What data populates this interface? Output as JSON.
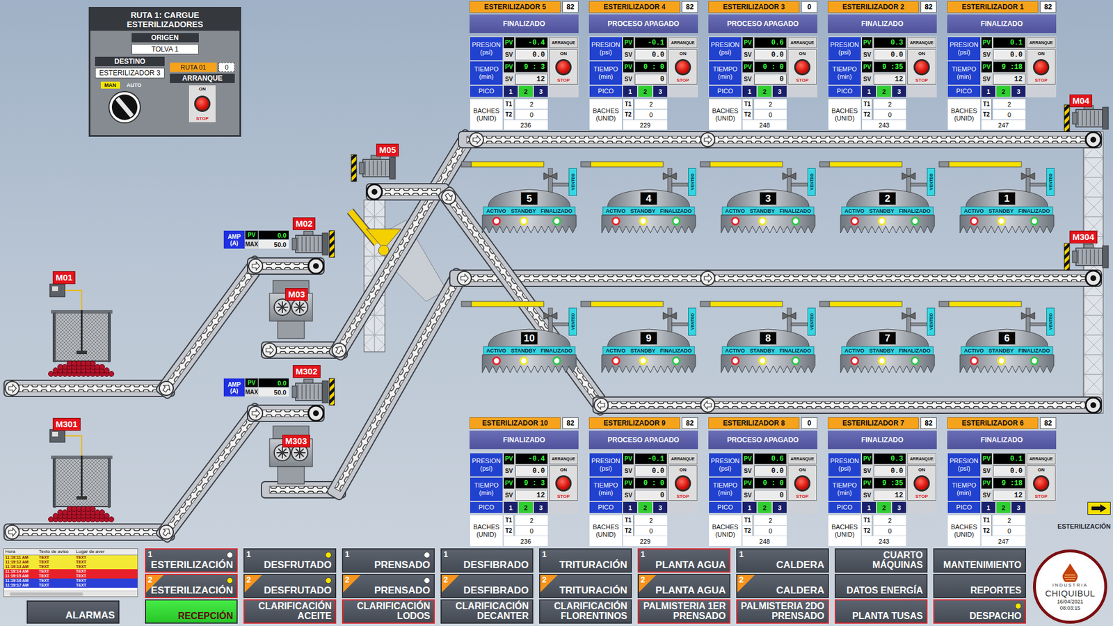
{
  "route_panel": {
    "title": "RUTA 1: CARGUE ESTERILIZADORES",
    "origin_label": "ORIGEN",
    "origin": "TOLVA 1",
    "destination_label": "DESTINO",
    "destination": "ESTERILIZADOR 3",
    "route_label": "RUTA 01",
    "route_value": "0",
    "start_label": "ARRANQUE",
    "modes": [
      {
        "label": "MAN",
        "selected": true
      },
      {
        "label": "AUTO",
        "selected": false
      }
    ],
    "on_label": "ON",
    "stop_label": "STOP"
  },
  "card_labels": {
    "pressure": "PRESION (psi)",
    "time": "TIEMPO (min)",
    "pv": "PV",
    "sv": "SV",
    "start": "ARRANQUE",
    "on": "ON",
    "stop": "STOP",
    "peak": "PICO",
    "batches": "BACHES (UNID)",
    "t1": "T1",
    "t2": "T2"
  },
  "sterilizers_top": [
    {
      "name": "ESTERILIZADOR 5",
      "count": "82",
      "status": "FINALIZADO",
      "pressure_pv": "-0.4",
      "pressure_sv": "0.0",
      "time_pv": "9 : 3",
      "time_sv": "12",
      "peaks": [
        {
          "label": "1",
          "selected": false
        },
        {
          "label": "2",
          "selected": true
        },
        {
          "label": "3",
          "selected": false
        }
      ],
      "t1": "2",
      "t2": "0",
      "total": "236"
    },
    {
      "name": "ESTERILIZADOR 4",
      "count": "82",
      "status": "PROCESO APAGADO",
      "pressure_pv": "-0.1",
      "pressure_sv": "0.0",
      "time_pv": "0 : 0",
      "time_sv": "0",
      "peaks": [
        {
          "label": "1",
          "selected": false
        },
        {
          "label": "2",
          "selected": true
        },
        {
          "label": "3",
          "selected": false
        }
      ],
      "t1": "2",
      "t2": "0",
      "total": "229"
    },
    {
      "name": "ESTERILIZADOR 3",
      "count": "0",
      "status": "PROCESO APAGADO",
      "pressure_pv": "0.6",
      "pressure_sv": "0.0",
      "time_pv": "0 : 0",
      "time_sv": "0",
      "peaks": [
        {
          "label": "1",
          "selected": false
        },
        {
          "label": "2",
          "selected": true
        },
        {
          "label": "3",
          "selected": false
        }
      ],
      "t1": "2",
      "t2": "0",
      "total": "248"
    },
    {
      "name": "ESTERILIZADOR 2",
      "count": "82",
      "status": "FINALIZADO",
      "pressure_pv": "0.3",
      "pressure_sv": "0.0",
      "time_pv": "9 :35",
      "time_sv": "12",
      "peaks": [
        {
          "label": "1",
          "selected": false
        },
        {
          "label": "2",
          "selected": true
        },
        {
          "label": "3",
          "selected": false
        }
      ],
      "t1": "2",
      "t2": "0",
      "total": "243"
    },
    {
      "name": "ESTERILIZADOR 1",
      "count": "82",
      "status": "FINALIZADO",
      "pressure_pv": "0.1",
      "pressure_sv": "0.0",
      "time_pv": "9 :18",
      "time_sv": "12",
      "peaks": [
        {
          "label": "1",
          "selected": false
        },
        {
          "label": "2",
          "selected": true
        },
        {
          "label": "3",
          "selected": false
        }
      ],
      "t1": "2",
      "t2": "0",
      "total": "247"
    }
  ],
  "sterilizers_bottom": [
    {
      "name": "ESTERILIZADOR 10",
      "count": "82",
      "status": "FINALIZADO",
      "pressure_pv": "-0.4",
      "pressure_sv": "0.0",
      "time_pv": "9 : 3",
      "time_sv": "12",
      "peaks": [
        {
          "label": "1",
          "selected": false
        },
        {
          "label": "2",
          "selected": true
        },
        {
          "label": "3",
          "selected": false
        }
      ],
      "t1": "2",
      "t2": "0",
      "total": "236"
    },
    {
      "name": "ESTERILIZADOR 9",
      "count": "82",
      "status": "PROCESO APAGADO",
      "pressure_pv": "-0.1",
      "pressure_sv": "0.0",
      "time_pv": "0 : 0",
      "time_sv": "0",
      "peaks": [
        {
          "label": "1",
          "selected": false
        },
        {
          "label": "2",
          "selected": true
        },
        {
          "label": "3",
          "selected": false
        }
      ],
      "t1": "2",
      "t2": "0",
      "total": "229"
    },
    {
      "name": "ESTERILIZADOR 8",
      "count": "0",
      "status": "PROCESO APAGADO",
      "pressure_pv": "0.6",
      "pressure_sv": "0.0",
      "time_pv": "0 : 0",
      "time_sv": "0",
      "peaks": [
        {
          "label": "1",
          "selected": false
        },
        {
          "label": "2",
          "selected": true
        },
        {
          "label": "3",
          "selected": false
        }
      ],
      "t1": "2",
      "t2": "0",
      "total": "248"
    },
    {
      "name": "ESTERILIZADOR 7",
      "count": "82",
      "status": "FINALIZADO",
      "pressure_pv": "0.3",
      "pressure_sv": "0.0",
      "time_pv": "9 :35",
      "time_sv": "12",
      "peaks": [
        {
          "label": "1",
          "selected": false
        },
        {
          "label": "2",
          "selected": true
        },
        {
          "label": "3",
          "selected": false
        }
      ],
      "t1": "2",
      "t2": "0",
      "total": "243"
    },
    {
      "name": "ESTERILIZADOR 6",
      "count": "82",
      "status": "FINALIZADO",
      "pressure_pv": "0.1",
      "pressure_sv": "0.0",
      "time_pv": "9 :18",
      "time_sv": "12",
      "peaks": [
        {
          "label": "1",
          "selected": false
        },
        {
          "label": "2",
          "selected": true
        },
        {
          "label": "3",
          "selected": false
        }
      ],
      "t1": "2",
      "t2": "0",
      "total": "247"
    }
  ],
  "vessel_labels": {
    "vent": "VENTEO",
    "lights": [
      {
        "label": "ACTIVO",
        "color": "#e5262b",
        "on": false
      },
      {
        "label": "STANDBY",
        "color": "#f3e62a",
        "on": false
      },
      {
        "label": "FINALIZADO",
        "color": "#2cc84a",
        "on": false
      }
    ]
  },
  "vessels_top": [
    {
      "number": "5"
    },
    {
      "number": "4"
    },
    {
      "number": "3"
    },
    {
      "number": "2"
    },
    {
      "number": "1"
    }
  ],
  "vessels_bottom": [
    {
      "number": "10"
    },
    {
      "number": "9"
    },
    {
      "number": "8"
    },
    {
      "number": "7"
    },
    {
      "number": "6"
    }
  ],
  "motors": [
    {
      "label": "M01"
    },
    {
      "label": "M301"
    },
    {
      "label": "M02"
    },
    {
      "label": "M03"
    },
    {
      "label": "M302"
    },
    {
      "label": "M303"
    },
    {
      "label": "M05"
    },
    {
      "label": "M04"
    },
    {
      "label": "M304"
    }
  ],
  "amp_meters": [
    {
      "label": "AMP (A)",
      "pv_label": "PV",
      "pv": "0.0",
      "max_label": "MAX",
      "max": "50.0"
    },
    {
      "label": "AMP (A)",
      "pv_label": "PV",
      "pv": "0.0",
      "max_label": "MAX",
      "max": "50.0"
    }
  ],
  "legend": {
    "label": "ESTERILIZACIÓN"
  },
  "alarms": {
    "columns": [
      "Hora",
      "Texto de aviso",
      "Lugar de aver"
    ],
    "rows": [
      {
        "time": "11:19:11 AM",
        "text": "TEXT",
        "place": "TEXT",
        "color": "#f3e833"
      },
      {
        "time": "11:19:12 AM",
        "text": "TEXT",
        "place": "TEXT",
        "color": "#f3e833"
      },
      {
        "time": "11:19:13 AM",
        "text": "TEXT",
        "place": "TEXT",
        "color": "#f3e833"
      },
      {
        "time": "11:19:14 AM",
        "text": "TEXT",
        "place": "TEXT",
        "color": "#e8202a"
      },
      {
        "time": "11:19:15 AM",
        "text": "TEXT",
        "place": "TEXT",
        "color": "#e8202a"
      },
      {
        "time": "11:19:16 AM",
        "text": "TEXT",
        "place": "TEXT",
        "color": "#2a3fd6"
      },
      {
        "time": "11:19:17 AM",
        "text": "TEXT",
        "place": "TEXT",
        "color": "#2a3fd6"
      }
    ]
  },
  "alarm_button": "ALARMAS",
  "nav": [
    {
      "label": "ESTERILIZACIÓN",
      "number": "1",
      "corner": null,
      "indicator": "#ffffff",
      "alarm": true,
      "selected": false
    },
    {
      "label": "DESFRUTADO",
      "number": "1",
      "corner": null,
      "indicator": "#f5e400",
      "alarm": false,
      "selected": false
    },
    {
      "label": "PRENSADO",
      "number": "1",
      "corner": null,
      "indicator": "#ffffff",
      "alarm": false,
      "selected": false
    },
    {
      "label": "DESFIBRADO",
      "number": "1",
      "corner": null,
      "indicator": null,
      "alarm": false,
      "selected": false
    },
    {
      "label": "TRITURACIÓN",
      "number": "1",
      "corner": null,
      "indicator": null,
      "alarm": false,
      "selected": false
    },
    {
      "label": "PLANTA AGUA",
      "number": "1",
      "corner": null,
      "indicator": null,
      "alarm": true,
      "selected": false
    },
    {
      "label": "CALDERA",
      "number": "1",
      "corner": null,
      "indicator": null,
      "alarm": false,
      "selected": false
    },
    {
      "label": "CUARTO MÁQUINAS",
      "number": null,
      "corner": null,
      "indicator": null,
      "alarm": false,
      "selected": false
    },
    {
      "label": "MANTENIMIENTO",
      "number": null,
      "corner": null,
      "indicator": null,
      "alarm": false,
      "selected": false
    },
    {
      "label": "ESTERILIZACIÓN",
      "number": "2",
      "corner": "#f7941d",
      "indicator": "#f5e400",
      "alarm": true,
      "selected": false
    },
    {
      "label": "DESFRUTADO",
      "number": "2",
      "corner": "#f7941d",
      "indicator": "#f5e400",
      "alarm": false,
      "selected": false
    },
    {
      "label": "PRENSADO",
      "number": "2",
      "corner": "#f7941d",
      "indicator": "#ffffff",
      "alarm": false,
      "selected": false
    },
    {
      "label": "DESFIBRADO",
      "number": "2",
      "corner": "#f7941d",
      "indicator": null,
      "alarm": false,
      "selected": false
    },
    {
      "label": "TRITURACIÓN",
      "number": "2",
      "corner": "#f7941d",
      "indicator": null,
      "alarm": false,
      "selected": false
    },
    {
      "label": "PLANTA AGUA",
      "number": "2",
      "corner": "#f7941d",
      "indicator": null,
      "alarm": false,
      "selected": false
    },
    {
      "label": "CALDERA",
      "number": "2",
      "corner": "#f7941d",
      "indicator": null,
      "alarm": false,
      "selected": false
    },
    {
      "label": "DATOS ENERGÍA",
      "number": null,
      "corner": null,
      "indicator": null,
      "alarm": false,
      "selected": false
    },
    {
      "label": "REPORTES",
      "number": null,
      "corner": null,
      "indicator": null,
      "alarm": false,
      "selected": false
    },
    {
      "label": "RECEPCIÓN",
      "number": null,
      "corner": null,
      "indicator": null,
      "alarm": false,
      "selected": true
    },
    {
      "label": "CLARIFICACIÓN ACEITE",
      "number": null,
      "corner": null,
      "indicator": null,
      "alarm": true,
      "selected": false
    },
    {
      "label": "CLARIFICACIÓN LODOS",
      "number": null,
      "corner": null,
      "indicator": null,
      "alarm": true,
      "selected": false
    },
    {
      "label": "CLARIFICACIÓN DECANTER",
      "number": null,
      "corner": null,
      "indicator": null,
      "alarm": false,
      "selected": false
    },
    {
      "label": "CLARIFICACIÓN FLORENTINOS",
      "number": null,
      "corner": null,
      "indicator": null,
      "alarm": false,
      "selected": false
    },
    {
      "label": "PALMISTERIA 1ER PRENSADO",
      "number": null,
      "corner": null,
      "indicator": null,
      "alarm": true,
      "selected": false
    },
    {
      "label": "PALMISTERIA 2DO PRENSADO",
      "number": null,
      "corner": null,
      "indicator": null,
      "alarm": true,
      "selected": false
    },
    {
      "label": "PLANTA TUSAS",
      "number": null,
      "corner": null,
      "indicator": null,
      "alarm": true,
      "selected": false
    },
    {
      "label": "DESPACHO",
      "number": null,
      "corner": null,
      "indicator": "#f5e400",
      "alarm": true,
      "selected": false
    }
  ],
  "logo": {
    "top": "INDUSTRIA",
    "name": "CHIQUIBUL",
    "date": "16/04/2021",
    "time": "08:03:15"
  }
}
